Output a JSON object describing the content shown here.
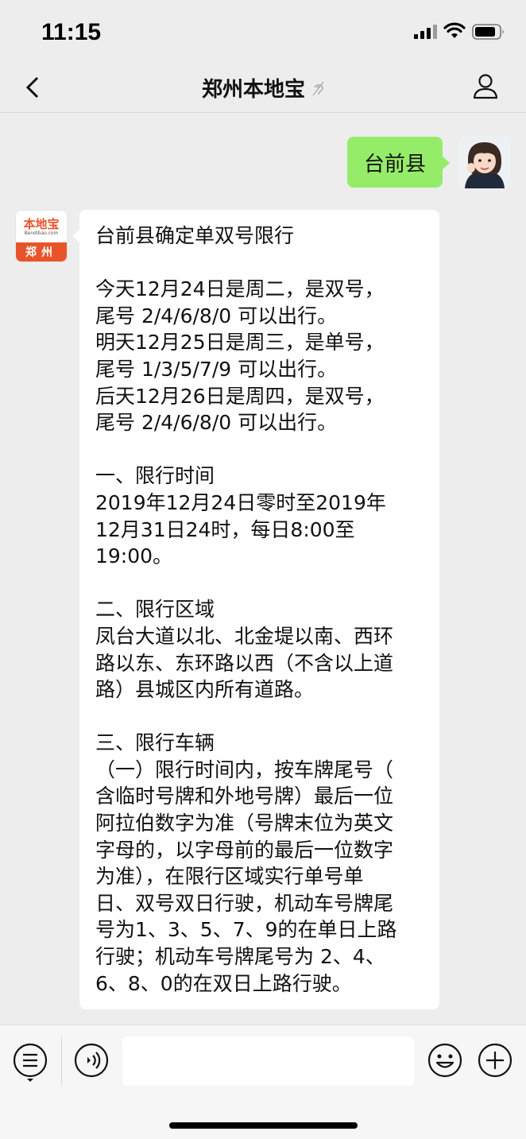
{
  "status_bar": {
    "time": "11:15",
    "icons": [
      "cellular-signal-icon",
      "wifi-icon",
      "battery-icon"
    ]
  },
  "nav": {
    "title": "郑州本地宝",
    "icons": [
      "back-icon",
      "mute-icon",
      "profile-icon"
    ]
  },
  "chat": {
    "outgoing": {
      "text": "台前县",
      "bubble_color": "#95ec69"
    },
    "bot": {
      "avatar_logo": "本地宝",
      "avatar_small": "Bendibao.com",
      "avatar_city": "郑州",
      "brand_color": "#e8542a"
    },
    "incoming_lines": [
      "台前县确定单双号限行",
      "",
      "今天12月24日是周二，是双号，",
      "尾号 2/4/6/8/0 可以出行。",
      "明天12月25日是周三，是单号，",
      "尾号 1/3/5/7/9 可以出行。",
      "后天12月26日是周四，是双号，",
      "尾号 2/4/6/8/0 可以出行。",
      "",
      "一、限行时间",
      "2019年12月24日零时至2019年",
      "12月31日24时，每日8:00至",
      "19:00。",
      "",
      "二、限行区域",
      "凤台大道以北、北金堤以南、西环",
      "路以东、东环路以西（不含以上道",
      "路）县城区内所有道路。",
      "",
      "三、限行车辆",
      "（一）限行时间内，按车牌尾号（",
      "含临时号牌和外地号牌）最后一位",
      "阿拉伯数字为准（号牌末位为英文",
      "字母的，以字母前的最后一位数字",
      "为准），在限行区域实行单号单",
      "日、双号双日行驶，机动车号牌尾",
      "号为1、3、5、7、9的在单日上路",
      "行驶；机动车号牌尾号为 2、4、",
      "6、8、0的在双日上路行驶。"
    ]
  },
  "input_bar": {
    "text_value": "",
    "icons": [
      "menu-icon",
      "voice-icon",
      "emoji-icon",
      "plus-icon"
    ]
  }
}
